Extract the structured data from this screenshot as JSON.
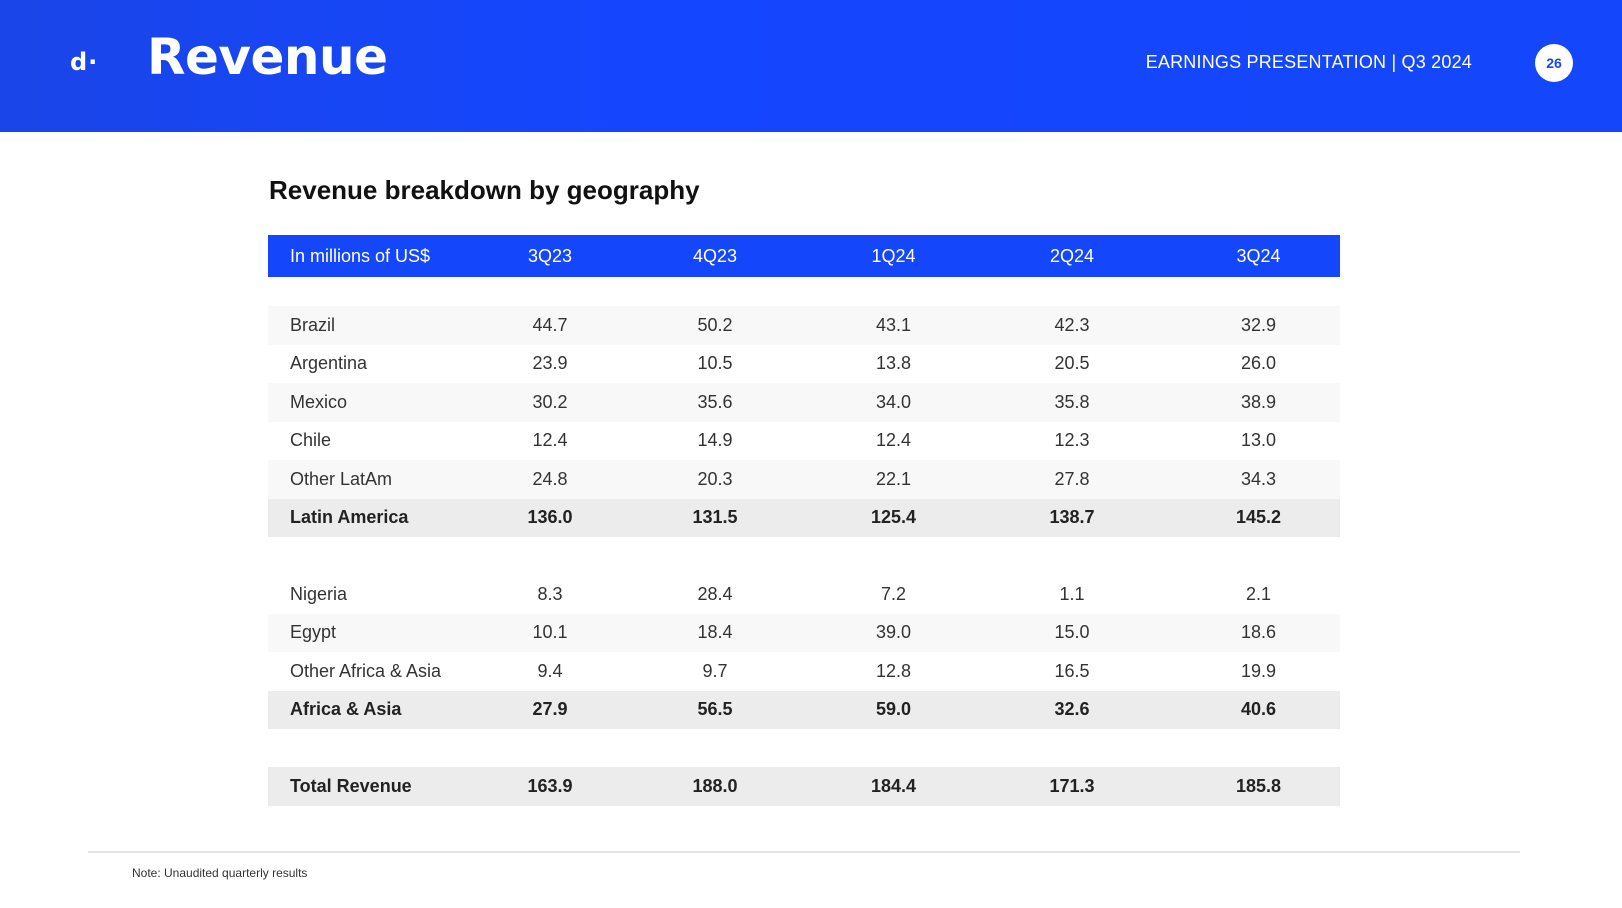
{
  "header": {
    "logo": "d·",
    "title": "Revenue",
    "presentation_label": "EARNINGS PRESENTATION | Q3 2024",
    "page_number": "26"
  },
  "section_title": "Revenue breakdown by geography",
  "table": {
    "unit_label": "In millions of US$",
    "columns": [
      "3Q23",
      "4Q23",
      "1Q24",
      "2Q24",
      "3Q24"
    ],
    "groups": [
      {
        "rows": [
          {
            "label": "Brazil",
            "values": [
              "44.7",
              "50.2",
              "43.1",
              "42.3",
              "32.9"
            ]
          },
          {
            "label": "Argentina",
            "values": [
              "23.9",
              "10.5",
              "13.8",
              "20.5",
              "26.0"
            ]
          },
          {
            "label": "Mexico",
            "values": [
              "30.2",
              "35.6",
              "34.0",
              "35.8",
              "38.9"
            ]
          },
          {
            "label": "Chile",
            "values": [
              "12.4",
              "14.9",
              "12.4",
              "12.3",
              "13.0"
            ]
          },
          {
            "label": "Other LatAm",
            "values": [
              "24.8",
              "20.3",
              "22.1",
              "27.8",
              "34.3"
            ]
          }
        ],
        "subtotal": {
          "label": "Latin America",
          "values": [
            "136.0",
            "131.5",
            "125.4",
            "138.7",
            "145.2"
          ]
        }
      },
      {
        "rows": [
          {
            "label": "Nigeria",
            "values": [
              "8.3",
              "28.4",
              "7.2",
              "1.1",
              "2.1"
            ]
          },
          {
            "label": "Egypt",
            "values": [
              "10.1",
              "18.4",
              "39.0",
              "15.0",
              "18.6"
            ]
          },
          {
            "label": "Other Africa & Asia",
            "values": [
              "9.4",
              "9.7",
              "12.8",
              "16.5",
              "19.9"
            ]
          }
        ],
        "subtotal": {
          "label": "Africa & Asia",
          "values": [
            "27.9",
            "56.5",
            "59.0",
            "32.6",
            "40.6"
          ]
        }
      }
    ],
    "total": {
      "label": "Total Revenue",
      "values": [
        "163.9",
        "188.0",
        "184.4",
        "171.3",
        "185.8"
      ]
    }
  },
  "footer": {
    "note": "Note: Unaudited quarterly results"
  },
  "colors": {
    "brand_blue": "#1446fb",
    "subtotal_bg": "#ececec",
    "row_shade": "#f8f8f8"
  }
}
